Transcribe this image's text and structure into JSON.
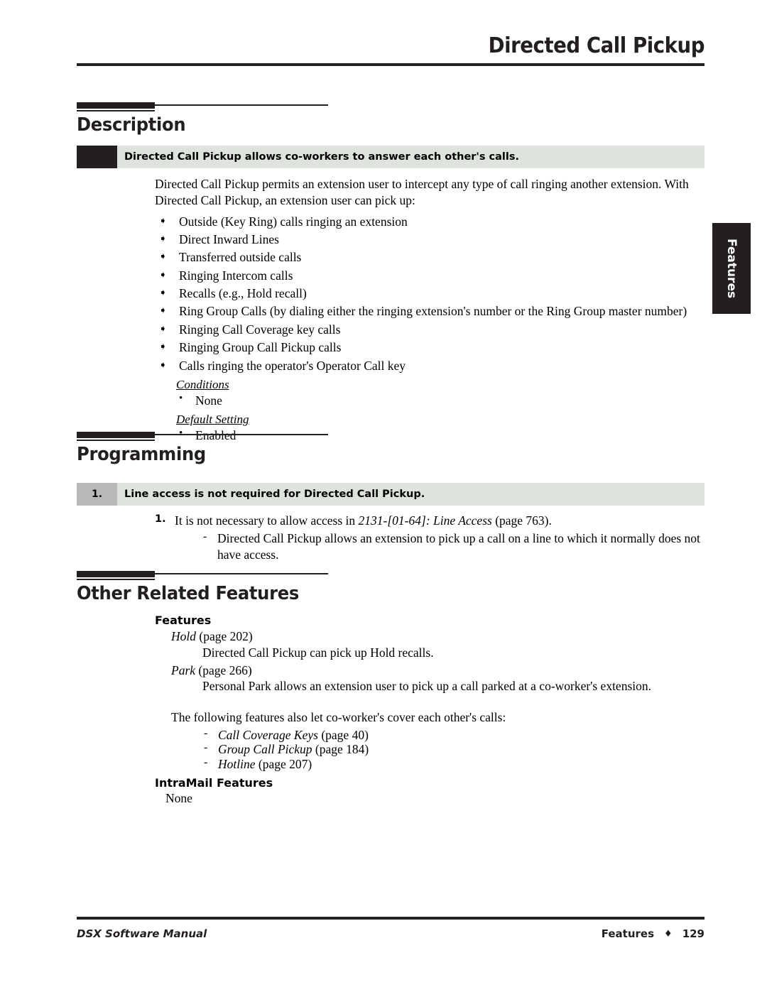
{
  "header": {
    "title": "Directed Call Pickup"
  },
  "side_tab": {
    "label": "Features"
  },
  "sections": {
    "description": {
      "title": "Description",
      "callout": "Directed Call Pickup allows co-workers to answer each other's calls.",
      "intro": "Directed Call Pickup permits an extension user to intercept any type of call ringing another extension. With Directed Call Pickup, an extension user can pick up:",
      "bullet_icon": "arrow-bullet-icon",
      "bullets": [
        "Outside (Key Ring) calls ringing an extension",
        "Direct Inward Lines",
        "Transferred outside calls",
        "Ringing Intercom calls",
        "Recalls (e.g., Hold recall)",
        "Ring Group Calls (by dialing either the ringing extension's number or the Ring Group master number)",
        "Ringing Call Coverage key calls",
        "Ringing Group Call Pickup calls",
        "Calls ringing the operator's Operator Call key"
      ],
      "conditions_heading": "Conditions",
      "conditions_items": [
        "None"
      ],
      "default_setting_heading": "Default Setting",
      "default_setting_items": [
        "Enabled"
      ]
    },
    "programming": {
      "title": "Programming",
      "callout_number": "1.",
      "callout": "Line access is not required for Directed Call Pickup.",
      "steps": [
        {
          "number": "1.",
          "text_before": "It is not necessary to allow access in ",
          "text_italic": "2131-[01-64]: Line Access",
          "text_after": " (page 763).",
          "sub_items": [
            "Directed Call Pickup allows an extension to pick up a call on a line to which it normally does not have access."
          ]
        }
      ]
    },
    "other_related_features": {
      "title": "Other Related Features",
      "features_heading": "Features",
      "feature_refs": [
        {
          "name": "Hold",
          "page": "(page 202)",
          "description": "Directed Call Pickup can pick up Hold recalls."
        },
        {
          "name": "Park",
          "page": "(page 266)",
          "description": "Personal Park allows an extension user to pick up a call parked at a co-worker's extension."
        }
      ],
      "also_intro": "The following features also let co-worker's cover each other's calls:",
      "also_items": [
        {
          "name": "Call Coverage Keys",
          "page": "(page 40)"
        },
        {
          "name": "Group Call Pickup",
          "page": "(page 184)"
        },
        {
          "name": "Hotline",
          "page": "(page 207)"
        }
      ],
      "intramail_heading": "IntraMail Features",
      "intramail_value": "None"
    }
  },
  "footer": {
    "left": "DSX Software Manual",
    "section": "Features",
    "diamond_icon": "diamond-icon",
    "page_number": "129"
  },
  "glyphs": {
    "arrow_bullet": "➧",
    "dot_bullet": "•",
    "dash_bullet": "-",
    "diamond": "♦"
  },
  "colors": {
    "ink": "#231f20",
    "callout_bg": "#dde4dc",
    "callout_marker": "#231f20",
    "callout_number_bg": "#b9b9b9",
    "tab_bg": "#231f20"
  }
}
